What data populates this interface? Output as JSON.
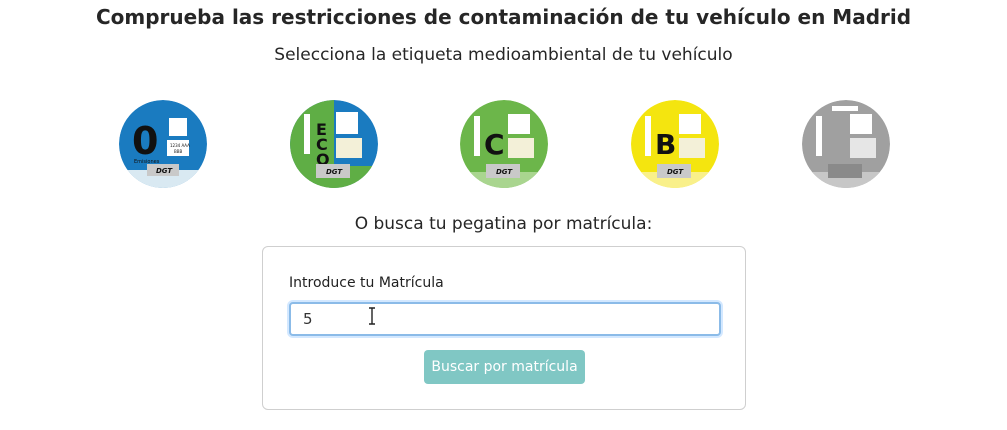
{
  "page": {
    "title": "Comprueba las restricciones de contaminación de tu vehículo en Madrid",
    "subtitle": "Selecciona la etiqueta medioambiental de tu vehículo",
    "or_label": "O busca tu pegatina por matrícula:"
  },
  "stickers": [
    {
      "name": "sticker-0-emisiones",
      "letter": "0",
      "caption": "Emisiones",
      "plate": "1234 AAA",
      "plate2": "BBB",
      "brand": "DGT",
      "colors": {
        "main": "#1a7bc0",
        "accent": "#1a7bc0"
      }
    },
    {
      "name": "sticker-eco",
      "letter": "ECO",
      "brand": "DGT",
      "colors": {
        "main": "#5fae45",
        "accent": "#1a7bc0"
      }
    },
    {
      "name": "sticker-c",
      "letter": "C",
      "brand": "DGT",
      "colors": {
        "main": "#6cb64a"
      }
    },
    {
      "name": "sticker-b",
      "letter": "B",
      "brand": "DGT",
      "colors": {
        "main": "#f4e50f"
      }
    },
    {
      "name": "sticker-sin-etiqueta",
      "letter": "",
      "brand": "",
      "colors": {
        "main": "#a0a0a0"
      }
    }
  ],
  "search": {
    "label": "Introduce tu Matrícula",
    "value": "5",
    "button_label": "Buscar por matrícula",
    "button_color": "#80c7c4",
    "focus_border_color": "#8bbbe8"
  }
}
